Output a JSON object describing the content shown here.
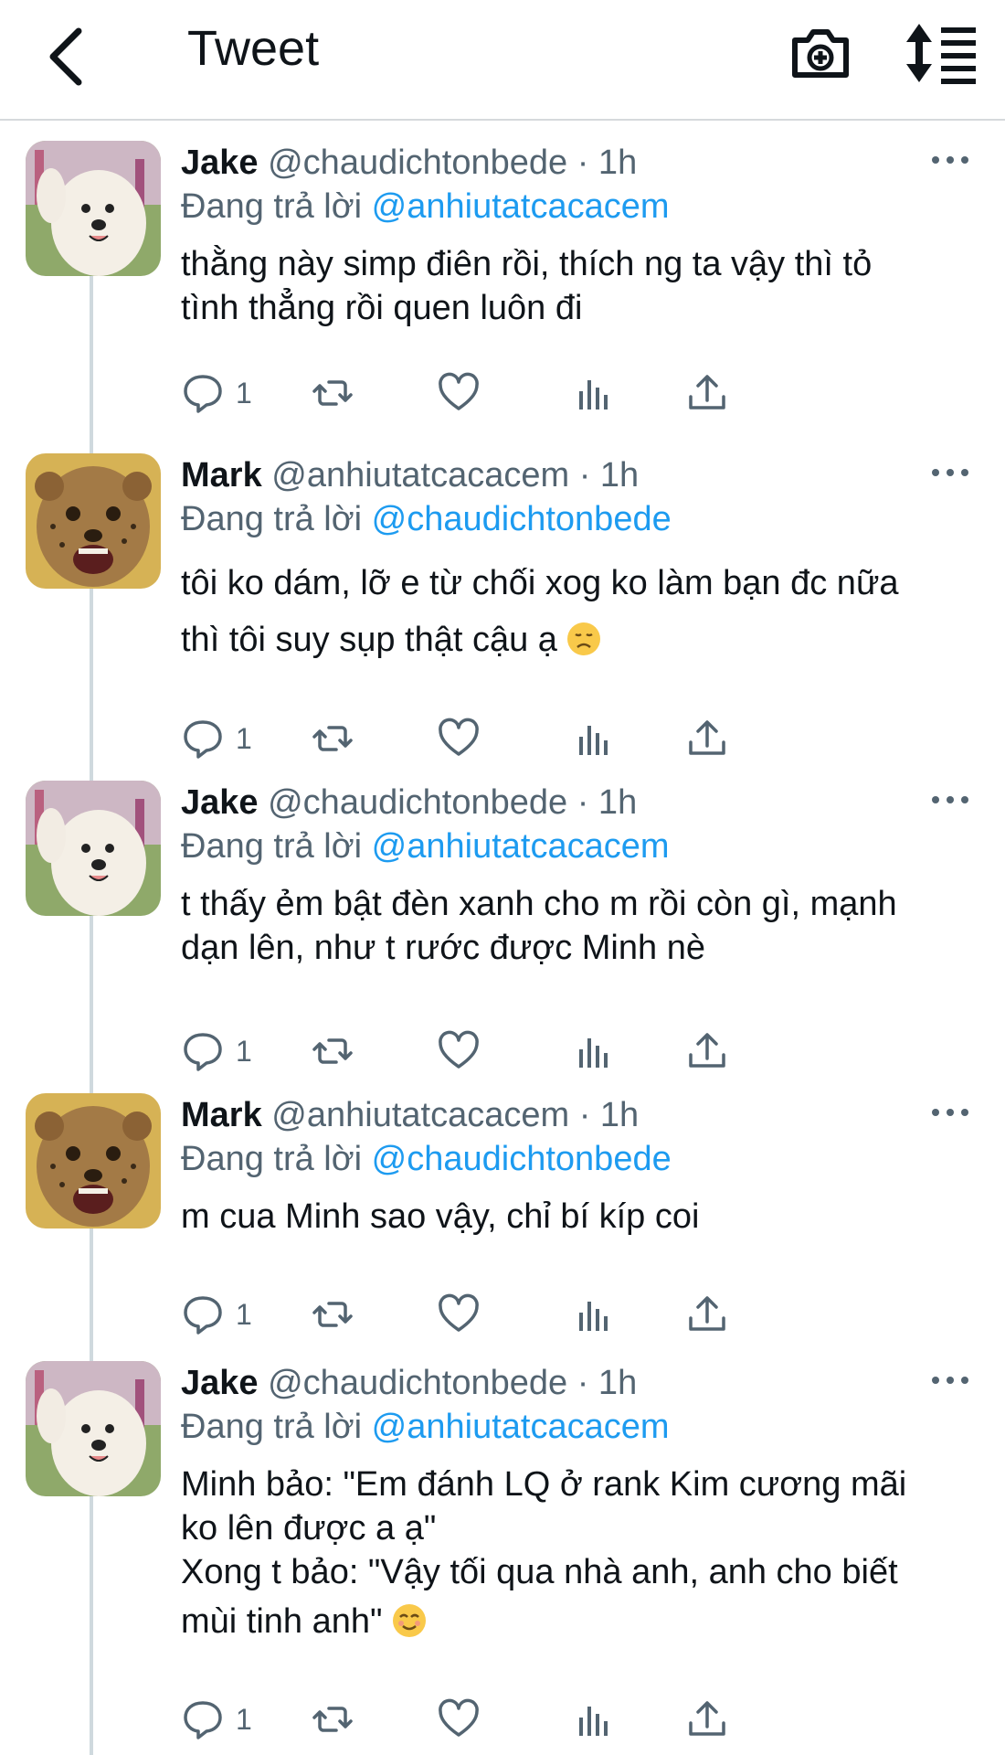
{
  "header": {
    "title": "Tweet"
  },
  "icons": {
    "back": "chevron-left-icon",
    "camera": "camera-plus-icon",
    "sort": "sort-icon",
    "more": "more-horizontal-icon",
    "reply": "reply-icon",
    "retweet": "retweet-icon",
    "like": "heart-icon",
    "stats": "analytics-icon",
    "share": "share-icon"
  },
  "colors": {
    "accent": "#1d9bf0",
    "secondary_text": "#536471",
    "divider": "#cfd9de"
  },
  "tweets": [
    {
      "name": "Jake",
      "handle": "@chaudichtonbede",
      "time": "· 1h",
      "reply_prefix": "Đang trả lời",
      "reply_to": "@anhiutatcacacem",
      "lines": [
        "thằng này simp điên rồi, thích ng ta vậy thì tỏ",
        "tình thẳng rồi quen luôn đi"
      ],
      "reply_count": "1",
      "avatar": "dog"
    },
    {
      "name": "Mark",
      "handle": "@anhiutatcacacem",
      "time": "· 1h",
      "reply_prefix": "Đang trả lời",
      "reply_to": "@chaudichtonbede",
      "lines": [
        "tôi ko dám, lỡ e từ chối xog ko làm bạn đc nữa",
        "thì tôi suy sụp thật cậu ạ"
      ],
      "emoji": "disappointed-face-emoji",
      "reply_count": "1",
      "avatar": "cheetah"
    },
    {
      "name": "Jake",
      "handle": "@chaudichtonbede",
      "time": "· 1h",
      "reply_prefix": "Đang trả lời",
      "reply_to": "@anhiutatcacacem",
      "lines": [
        "t thấy ẻm bật đèn xanh cho m rồi còn gì, mạnh",
        "dạn lên, như t rước được Minh nè"
      ],
      "reply_count": "1",
      "avatar": "dog"
    },
    {
      "name": "Mark",
      "handle": "@anhiutatcacacem",
      "time": "· 1h",
      "reply_prefix": "Đang trả lời",
      "reply_to": "@chaudichtonbede",
      "lines": [
        "m cua Minh sao vậy, chỉ bí kíp coi"
      ],
      "reply_count": "1",
      "avatar": "cheetah"
    },
    {
      "name": "Jake",
      "handle": "@chaudichtonbede",
      "time": "· 1h",
      "reply_prefix": "Đang trả lời",
      "reply_to": "@anhiutatcacacem",
      "lines": [
        "Minh bảo: \"Em đánh LQ ở rank Kim cương mãi",
        "ko lên được a ạ\"",
        "Xong t bảo: \"Vậy tối qua nhà anh, anh cho biết",
        "mùi tinh anh\""
      ],
      "emoji": "smiling-face-emoji",
      "reply_count": "1",
      "avatar": "dog"
    }
  ]
}
